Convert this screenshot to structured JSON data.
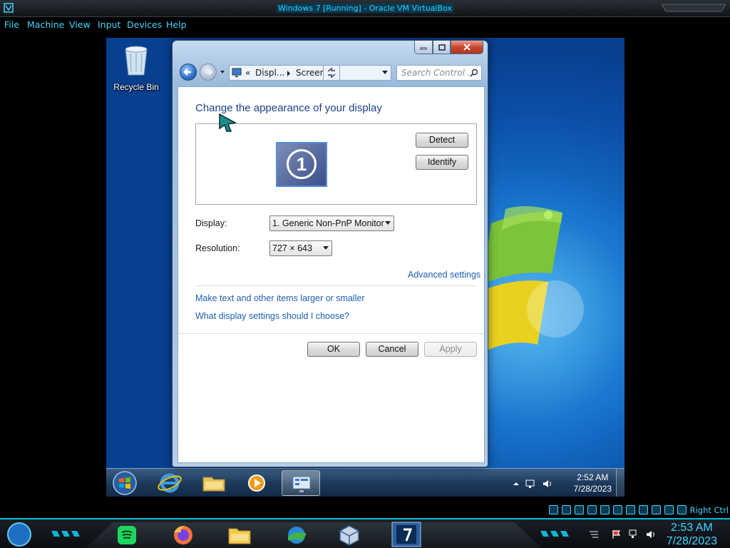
{
  "host": {
    "title": "Windows 7 [Running] - Oracle VM VirtualBox",
    "menu": [
      "File",
      "Machine",
      "View",
      "Input",
      "Devices",
      "Help"
    ],
    "host_key": "Right Ctrl",
    "clock_time": "2:53 AM",
    "clock_date": "7/28/2023"
  },
  "guest": {
    "desktop_icons": [
      {
        "label": "Recycle Bin"
      }
    ],
    "clock_time": "2:52 AM",
    "clock_date": "7/28/2023"
  },
  "dialog": {
    "address": {
      "chevrons": "«",
      "seg1": "Displ...",
      "seg2": "Screen ..."
    },
    "search_placeholder": "Search Control ...",
    "heading": "Change the appearance of your display",
    "monitor_number": "1",
    "detect_label": "Detect",
    "identify_label": "Identify",
    "display_label": "Display:",
    "display_value": "1. Generic Non-PnP Monitor",
    "resolution_label": "Resolution:",
    "resolution_value": "727 × 643",
    "advanced_link": "Advanced settings",
    "link_text_size": "Make text and other items larger or smaller",
    "link_which_settings": "What display settings should I choose?",
    "ok_label": "OK",
    "cancel_label": "Cancel",
    "apply_label": "Apply"
  },
  "colors": {
    "accent_cyan": "#3fd7ff",
    "link_blue": "#1e5fb3",
    "heading_blue": "#1e3f8e"
  }
}
